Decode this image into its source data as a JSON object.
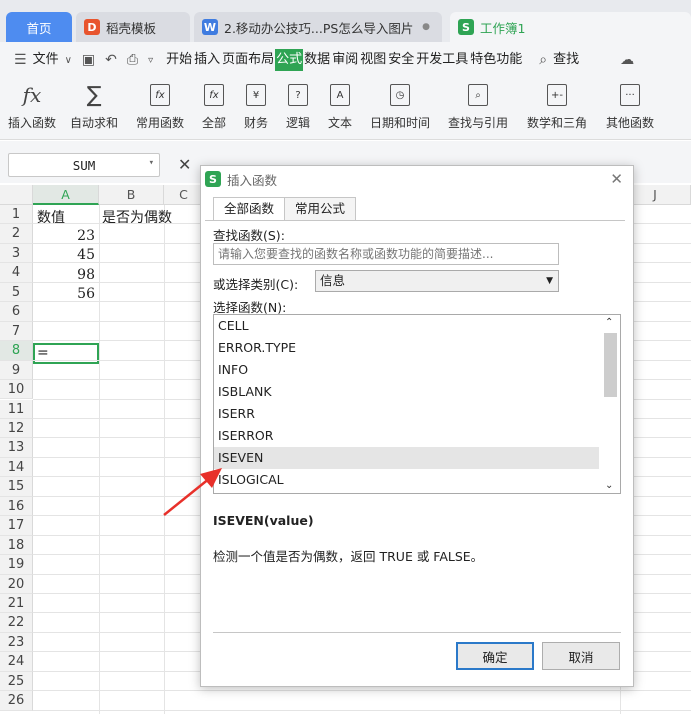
{
  "tabs": {
    "home": "首页",
    "template": "稻壳模板",
    "doc": "2.移动办公技巧...PS怎么导入图片",
    "workbook": "工作簿1"
  },
  "menu": {
    "file": "文件",
    "items": [
      "开始",
      "插入",
      "页面布局",
      "公式",
      "数据",
      "审阅",
      "视图",
      "安全",
      "开发工具",
      "特色功能"
    ],
    "search": "查找"
  },
  "ribbon": {
    "items": [
      "插入函数",
      "自动求和",
      "常用函数",
      "全部",
      "财务",
      "逻辑",
      "文本",
      "日期和时间",
      "查找与引用",
      "数学和三角",
      "其他函数"
    ]
  },
  "formula": {
    "name_box": "SUM",
    "fx": "fx",
    "content": "="
  },
  "sheet": {
    "columns": [
      "A",
      "B",
      "C",
      "J"
    ],
    "rows": [
      "1",
      "2",
      "3",
      "4",
      "5",
      "6",
      "7",
      "8",
      "9",
      "10",
      "11",
      "12",
      "13",
      "14",
      "15",
      "16",
      "17",
      "18",
      "19",
      "20",
      "21",
      "22",
      "23",
      "24",
      "25",
      "26"
    ],
    "cells": {
      "A1": "数值",
      "B1": "是否为偶数",
      "A2": "23",
      "A3": "45",
      "A4": "98",
      "A5": "56",
      "A8": "="
    }
  },
  "dialog": {
    "title": "插入函数",
    "tabs": [
      "全部函数",
      "常用公式"
    ],
    "search_label": "查找函数(S):",
    "search_placeholder": "请输入您要查找的函数名称或函数功能的简要描述...",
    "category_label": "或选择类别(C):",
    "category_value": "信息",
    "list_label": "选择函数(N):",
    "functions": [
      "CELL",
      "ERROR.TYPE",
      "INFO",
      "ISBLANK",
      "ISERR",
      "ISERROR",
      "ISEVEN",
      "ISLOGICAL"
    ],
    "selected_function": "ISEVEN",
    "signature": "ISEVEN(value)",
    "description": "检测一个值是否为偶数，返回 TRUE 或 FALSE。",
    "ok": "确定",
    "cancel": "取消"
  },
  "colors": {
    "accent_green": "#2fa454",
    "home_tab": "#4e8cf0",
    "arrow": "#e8302a"
  }
}
